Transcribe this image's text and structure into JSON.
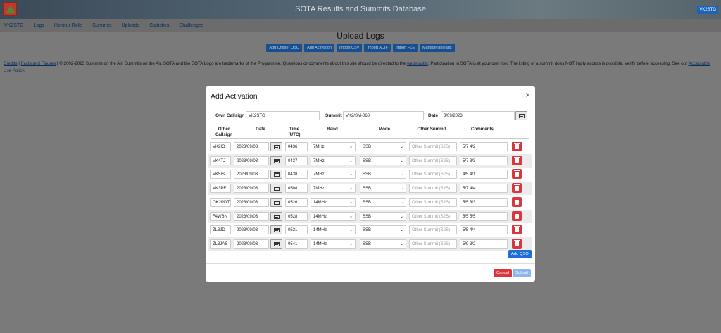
{
  "header": {
    "title": "SOTA Results and Summits Database",
    "user_button": "VK2STG"
  },
  "nav": [
    "VK2STG",
    "Logs",
    "Honour Rolls",
    "Summits",
    "Uploads",
    "Statistics",
    "Challenges"
  ],
  "page": {
    "title": "Upload Logs",
    "buttons": [
      "Add Chaser QSO",
      "Add Activation",
      "Import CSV",
      "Import ADIF",
      "Import FLE",
      "Manage Uploads"
    ]
  },
  "footer": {
    "credits": "Credits",
    "sep1": " | ",
    "facts": "Facts and Figures",
    "text1": " | © 2002-2023 Summits on the Air. Summits on the Air, SOTA and the SOTA Logo are trademarks of the Programme. Questions or comments about this site should be directed to the ",
    "webmaster": "webmaster",
    "text2": ". Participation in SOTA is at your own risk. The listing of a summit does NOT imply access is possible. Verify before accessing. See our ",
    "aup": "Acceptable Use Policy."
  },
  "modal": {
    "title": "Add Activation",
    "close": "×",
    "own_callsign_label": "Own Callsign",
    "own_callsign": "VK2STG",
    "summit_label": "Summit",
    "summit": "VK2/SM-068",
    "date_label": "Date",
    "date": "3/09/2023",
    "columns": {
      "other_callsign": "Other\nCallsign",
      "date": "Date",
      "time": "Time\n(UTC)",
      "band": "Band",
      "mode": "Mode",
      "other_summit": "Other Summit",
      "comments": "Comments"
    },
    "other_summit_placeholder": "Other Summit (S2S)",
    "rows": [
      {
        "callsign": "VK2IO",
        "date": "2023/09/03",
        "time": "0436",
        "band": "7MHz",
        "mode": "SSB",
        "comments": "5/7 4/2"
      },
      {
        "callsign": "VK4TJ",
        "date": "2023/09/03",
        "time": "0437",
        "band": "7MHz",
        "mode": "SSB",
        "comments": "5/7 3/3"
      },
      {
        "callsign": "VK5IS",
        "date": "2023/09/03",
        "time": "0438",
        "band": "7MHz",
        "mode": "SSB",
        "comments": "4/5 4/1"
      },
      {
        "callsign": "VK3PF",
        "date": "2023/09/03",
        "time": "0508",
        "band": "7MHz",
        "mode": "SSB",
        "comments": "5/7 4/4"
      },
      {
        "callsign": "OK2PDT",
        "date": "2023/09/03",
        "time": "0526",
        "band": "14MHz",
        "mode": "SSB",
        "comments": "5/5 3/3"
      },
      {
        "callsign": "F4WBN",
        "date": "2023/09/03",
        "time": "0528",
        "band": "14MHz",
        "mode": "SSB",
        "comments": "5/5 5/5"
      },
      {
        "callsign": "ZL3JD",
        "date": "2023/09/03",
        "time": "0531",
        "band": "14MHz",
        "mode": "SSB",
        "comments": "5/5 4/4"
      },
      {
        "callsign": "ZL3JAS",
        "date": "2023/09/03",
        "time": "0541",
        "band": "14MHz",
        "mode": "SSB",
        "comments": "5/9 3/2"
      }
    ],
    "add_qso": "Add QSO",
    "cancel": "Cancel",
    "submit": "Submit"
  },
  "colors": {
    "primary": "#1e6fd9",
    "danger": "#d9363e",
    "overlay": "#7a7a7a"
  }
}
